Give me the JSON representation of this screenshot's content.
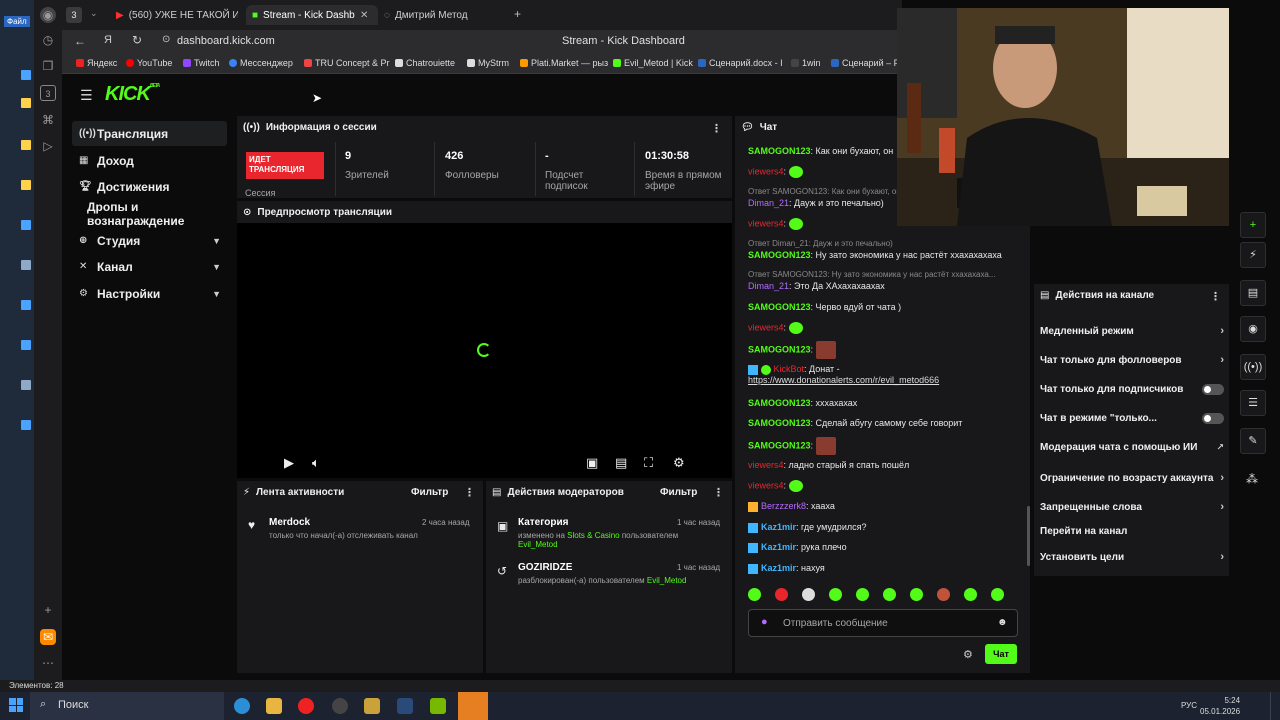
{
  "desktop": {
    "file_label": "Файл"
  },
  "tabs": [
    {
      "label": "(560) УЖЕ НЕ ТАКОЙ И Н"
    },
    {
      "label": "Stream - Kick Dashboard"
    },
    {
      "label": "Дмитрий Метод"
    }
  ],
  "tab_count": "3",
  "address": {
    "url": "dashboard.kick.com",
    "page_title": "Stream - Kick Dashboard"
  },
  "bookmarks": [
    "Яндекс",
    "YouTube",
    "Twitch",
    "Мессенджер",
    "TRU Concept & Pr",
    "Chatrouiette",
    "MyStrm",
    "Plati.Market — рыз",
    "Evil_Metod | Kick",
    "Сценарий.docx - I",
    "1win",
    "Сценарий – F"
  ],
  "logo": {
    "text": "KICK",
    "beta": "BETA"
  },
  "nav": [
    {
      "label": "Трансляция"
    },
    {
      "label": "Доход"
    },
    {
      "label": "Достижения"
    },
    {
      "label": "Дропы и вознаграждение"
    },
    {
      "label": "Студия"
    },
    {
      "label": "Канал"
    },
    {
      "label": "Настройки"
    }
  ],
  "session": {
    "title": "Информация о сессии",
    "live_line1": "ИДЕТ",
    "live_line2": "ТРАНСЛЯЦИЯ",
    "live_sub": "Сессия",
    "stats": [
      {
        "value": "9",
        "label": "Зрителей"
      },
      {
        "value": "426",
        "label": "Фолловеры"
      },
      {
        "value": "-",
        "label": "Подсчет подписок"
      },
      {
        "value": "01:30:58",
        "label": "Время в прямом эфире"
      }
    ]
  },
  "preview": {
    "title": "Предпросмотр трансляции"
  },
  "activity": {
    "title": "Лента активности",
    "filter": "Фильтр",
    "items": [
      {
        "user": "Merdock",
        "text": "только что начал(-а) отслеживать канал",
        "time": "2 часа назад"
      }
    ]
  },
  "mod": {
    "title": "Действия модераторов",
    "filter": "Фильтр",
    "items": [
      {
        "title": "Категория",
        "pre": "изменено на ",
        "cat": "Slots & Casino",
        "mid": " пользователем ",
        "user": "Evil_Metod",
        "time": "1 час назад"
      },
      {
        "title": "GOZIRIDZE",
        "pre": "разблокирован(-а) пользователем ",
        "user": "Evil_Metod",
        "time": "1 час назад"
      }
    ]
  },
  "chat": {
    "title": "Чат",
    "placeholder": "Отправить сообщение",
    "send": "Чат",
    "messages": [
      {
        "user": "SAMOGON123",
        "text": "Как они бухают, он"
      },
      {
        "user": "viewers4",
        "text": ""
      },
      {
        "reply": "Ответ SAMOGON123: Как они бухают, он"
      },
      {
        "user": "Diman_21",
        "text": "Дауж и это печально)"
      },
      {
        "user": "viewers4",
        "text": ""
      },
      {
        "reply": "Ответ Diman_21: Дауж и это печально)"
      },
      {
        "user": "SAMOGON123",
        "text": "Ну зато экономика у нас растёт ххахахахаха"
      },
      {
        "reply": "Ответ SAMOGON123: Ну зато экономика у нас растёт ххахахаха..."
      },
      {
        "user": "Diman_21",
        "text": "Это Да ХАхахахаахах"
      },
      {
        "user": "SAMOGON123",
        "text": "Черво вдуй от чата )"
      },
      {
        "user": "viewers4",
        "text": ""
      },
      {
        "user": "SAMOGON123",
        "text": ""
      },
      {
        "user": "KickBot",
        "text": "Донат -",
        "link": "https://www.donationalerts.com/r/evil_metod666"
      },
      {
        "user": "SAMOGON123",
        "text": "хххахахах"
      },
      {
        "user": "SAMOGON123",
        "text": "Сделай абугу самому себе говорит"
      },
      {
        "user": "SAMOGON123",
        "text": ""
      },
      {
        "user": "viewers4",
        "text": "ладно старый я спать пошёл"
      },
      {
        "user": "viewers4",
        "text": ""
      },
      {
        "user": "Berzzzerk8",
        "text": "хааха"
      },
      {
        "user": "Kaz1mir",
        "text": "где умудрился?"
      },
      {
        "user": "Kaz1mir",
        "text": "рука плечо"
      },
      {
        "user": "Kaz1mir",
        "text": "нахуя"
      }
    ]
  },
  "channel_actions": {
    "title": "Действия на канале",
    "items": [
      "Медленный режим",
      "Чат только для фолловеров",
      "Чат только для подписчиков",
      "Чат в режиме \"только...",
      "Модерация чата с помощью ИИ",
      "Ограничение по возрасту аккаунта",
      "Запрещенные слова",
      "Перейти на канал",
      "Установить цели"
    ]
  },
  "status": {
    "text": "Элементов: 28"
  },
  "taskbar": {
    "search": "Поиск",
    "lang": "РУС",
    "time": "5:24",
    "date": "05.01.2026"
  },
  "colors": {
    "kick_green": "#53fc18",
    "live_red": "#e9262d",
    "panel": "#18181b",
    "bg": "#0b0b0c"
  }
}
